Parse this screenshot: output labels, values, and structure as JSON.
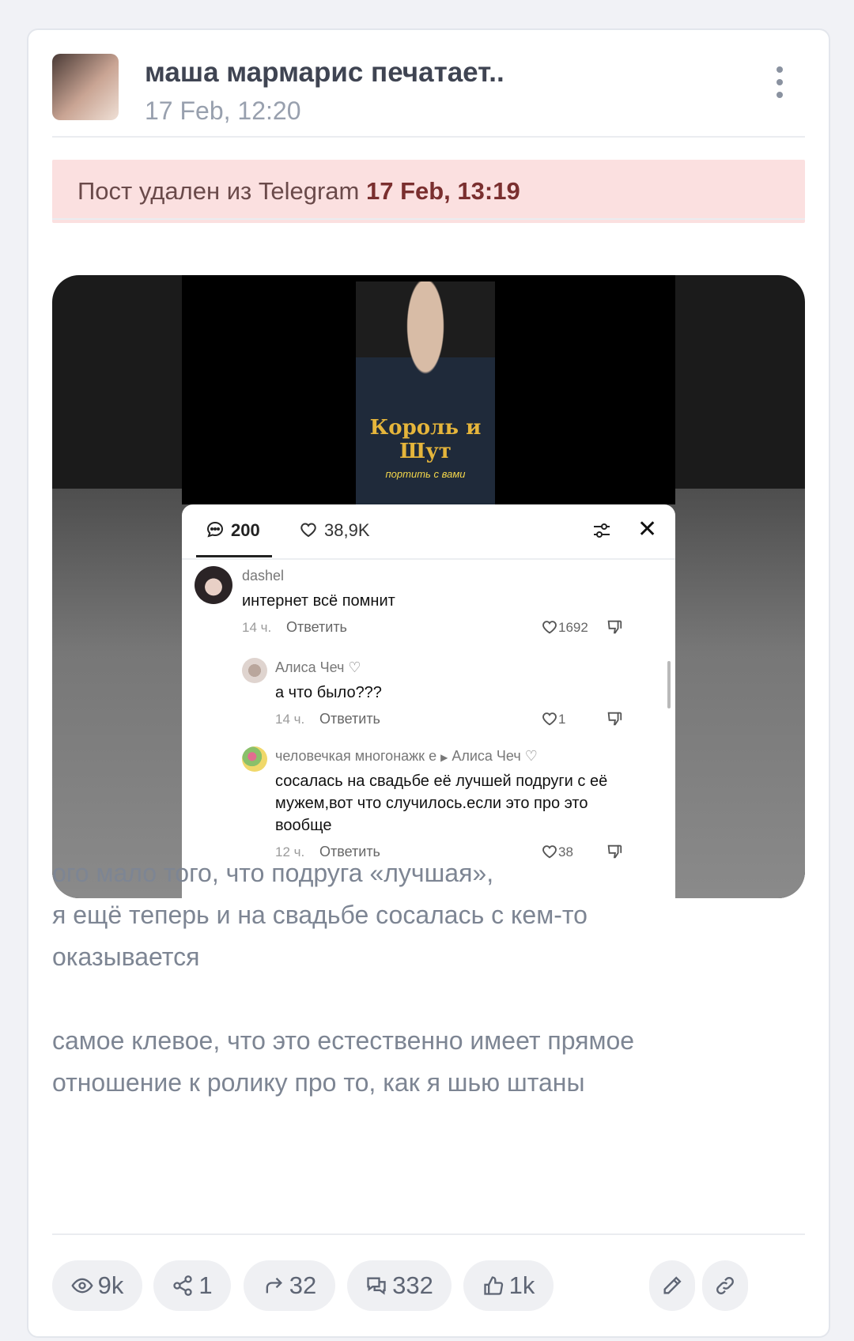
{
  "post": {
    "author": "маша мармарис печатает..",
    "date": "17 Feb, 12:20",
    "deleted_notice": {
      "text": "Пост удален из Telegram",
      "date": "17 Feb, 13:19"
    },
    "text_lines": [
      "ого мало того, что подруга «лучшая»,",
      "я ещё теперь и на свадьбе сосалась с кем-то",
      "оказывается",
      "",
      "самое клевое, что это естественно имеет прямое",
      "отношение к ролику про то, как я шью штаны"
    ]
  },
  "video": {
    "shirt_text": "Король и Шут",
    "subtitle": "портить с вами"
  },
  "comments_panel": {
    "comment_count": "200",
    "like_count": "38,9K",
    "comments": [
      {
        "user": "dashel",
        "text": "интернет всё помнит",
        "time": "14 ч.",
        "reply": "Ответить",
        "likes": "1692"
      },
      {
        "user": "Алиса Чеч ♡",
        "text": "а что было???",
        "time": "14 ч.",
        "reply": "Ответить",
        "likes": "1"
      },
      {
        "user": "человечкая многонажк е",
        "reply_to": "Алиса Чеч ♡",
        "text": "сосалась на свадьбе её лучшей подруги с её мужем,вот что случилось.если это про это вообще",
        "time": "12 ч.",
        "reply": "Ответить",
        "likes": "38"
      }
    ]
  },
  "stats": {
    "views": "9k",
    "shares": "1",
    "forwards": "32",
    "comments": "332",
    "reactions": "1k"
  },
  "icons": [
    "more-vertical-icon",
    "eye-icon",
    "share-icon",
    "forward-icon",
    "comments-icon",
    "thumbs-up-icon",
    "edit-icon",
    "link-icon",
    "comment-bubble-icon",
    "heart-icon",
    "filter-icon",
    "close-icon",
    "dislike-icon"
  ],
  "colors": {
    "alert_bg": "#fbe0e0",
    "alert_text": "#7a2f2f",
    "pill_bg": "#eff0f3"
  }
}
